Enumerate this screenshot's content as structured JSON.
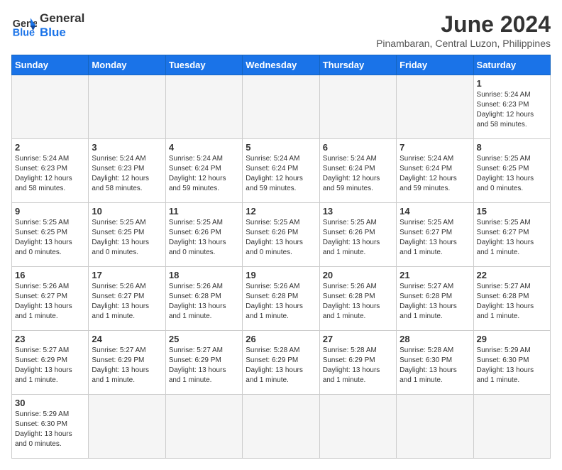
{
  "header": {
    "logo_general": "General",
    "logo_blue": "Blue",
    "title": "June 2024",
    "subtitle": "Pinambaran, Central Luzon, Philippines"
  },
  "weekdays": [
    "Sunday",
    "Monday",
    "Tuesday",
    "Wednesday",
    "Thursday",
    "Friday",
    "Saturday"
  ],
  "weeks": [
    [
      {
        "day": "",
        "info": "",
        "empty": true
      },
      {
        "day": "",
        "info": "",
        "empty": true
      },
      {
        "day": "",
        "info": "",
        "empty": true
      },
      {
        "day": "",
        "info": "",
        "empty": true
      },
      {
        "day": "",
        "info": "",
        "empty": true
      },
      {
        "day": "",
        "info": "",
        "empty": true
      },
      {
        "day": "1",
        "info": "Sunrise: 5:24 AM\nSunset: 6:23 PM\nDaylight: 12 hours\nand 58 minutes."
      }
    ],
    [
      {
        "day": "2",
        "info": "Sunrise: 5:24 AM\nSunset: 6:23 PM\nDaylight: 12 hours\nand 58 minutes."
      },
      {
        "day": "3",
        "info": "Sunrise: 5:24 AM\nSunset: 6:23 PM\nDaylight: 12 hours\nand 58 minutes."
      },
      {
        "day": "4",
        "info": "Sunrise: 5:24 AM\nSunset: 6:24 PM\nDaylight: 12 hours\nand 59 minutes."
      },
      {
        "day": "5",
        "info": "Sunrise: 5:24 AM\nSunset: 6:24 PM\nDaylight: 12 hours\nand 59 minutes."
      },
      {
        "day": "6",
        "info": "Sunrise: 5:24 AM\nSunset: 6:24 PM\nDaylight: 12 hours\nand 59 minutes."
      },
      {
        "day": "7",
        "info": "Sunrise: 5:24 AM\nSunset: 6:24 PM\nDaylight: 12 hours\nand 59 minutes."
      },
      {
        "day": "8",
        "info": "Sunrise: 5:25 AM\nSunset: 6:25 PM\nDaylight: 13 hours\nand 0 minutes."
      }
    ],
    [
      {
        "day": "9",
        "info": "Sunrise: 5:25 AM\nSunset: 6:25 PM\nDaylight: 13 hours\nand 0 minutes."
      },
      {
        "day": "10",
        "info": "Sunrise: 5:25 AM\nSunset: 6:25 PM\nDaylight: 13 hours\nand 0 minutes."
      },
      {
        "day": "11",
        "info": "Sunrise: 5:25 AM\nSunset: 6:26 PM\nDaylight: 13 hours\nand 0 minutes."
      },
      {
        "day": "12",
        "info": "Sunrise: 5:25 AM\nSunset: 6:26 PM\nDaylight: 13 hours\nand 0 minutes."
      },
      {
        "day": "13",
        "info": "Sunrise: 5:25 AM\nSunset: 6:26 PM\nDaylight: 13 hours\nand 1 minute."
      },
      {
        "day": "14",
        "info": "Sunrise: 5:25 AM\nSunset: 6:27 PM\nDaylight: 13 hours\nand 1 minute."
      },
      {
        "day": "15",
        "info": "Sunrise: 5:25 AM\nSunset: 6:27 PM\nDaylight: 13 hours\nand 1 minute."
      }
    ],
    [
      {
        "day": "16",
        "info": "Sunrise: 5:26 AM\nSunset: 6:27 PM\nDaylight: 13 hours\nand 1 minute."
      },
      {
        "day": "17",
        "info": "Sunrise: 5:26 AM\nSunset: 6:27 PM\nDaylight: 13 hours\nand 1 minute."
      },
      {
        "day": "18",
        "info": "Sunrise: 5:26 AM\nSunset: 6:28 PM\nDaylight: 13 hours\nand 1 minute."
      },
      {
        "day": "19",
        "info": "Sunrise: 5:26 AM\nSunset: 6:28 PM\nDaylight: 13 hours\nand 1 minute."
      },
      {
        "day": "20",
        "info": "Sunrise: 5:26 AM\nSunset: 6:28 PM\nDaylight: 13 hours\nand 1 minute."
      },
      {
        "day": "21",
        "info": "Sunrise: 5:27 AM\nSunset: 6:28 PM\nDaylight: 13 hours\nand 1 minute."
      },
      {
        "day": "22",
        "info": "Sunrise: 5:27 AM\nSunset: 6:28 PM\nDaylight: 13 hours\nand 1 minute."
      }
    ],
    [
      {
        "day": "23",
        "info": "Sunrise: 5:27 AM\nSunset: 6:29 PM\nDaylight: 13 hours\nand 1 minute."
      },
      {
        "day": "24",
        "info": "Sunrise: 5:27 AM\nSunset: 6:29 PM\nDaylight: 13 hours\nand 1 minute."
      },
      {
        "day": "25",
        "info": "Sunrise: 5:27 AM\nSunset: 6:29 PM\nDaylight: 13 hours\nand 1 minute."
      },
      {
        "day": "26",
        "info": "Sunrise: 5:28 AM\nSunset: 6:29 PM\nDaylight: 13 hours\nand 1 minute."
      },
      {
        "day": "27",
        "info": "Sunrise: 5:28 AM\nSunset: 6:29 PM\nDaylight: 13 hours\nand 1 minute."
      },
      {
        "day": "28",
        "info": "Sunrise: 5:28 AM\nSunset: 6:30 PM\nDaylight: 13 hours\nand 1 minute."
      },
      {
        "day": "29",
        "info": "Sunrise: 5:29 AM\nSunset: 6:30 PM\nDaylight: 13 hours\nand 1 minute."
      }
    ],
    [
      {
        "day": "30",
        "info": "Sunrise: 5:29 AM\nSunset: 6:30 PM\nDaylight: 13 hours\nand 0 minutes."
      },
      {
        "day": "",
        "info": "",
        "empty": true
      },
      {
        "day": "",
        "info": "",
        "empty": true
      },
      {
        "day": "",
        "info": "",
        "empty": true
      },
      {
        "day": "",
        "info": "",
        "empty": true
      },
      {
        "day": "",
        "info": "",
        "empty": true
      },
      {
        "day": "",
        "info": "",
        "empty": true
      }
    ]
  ]
}
